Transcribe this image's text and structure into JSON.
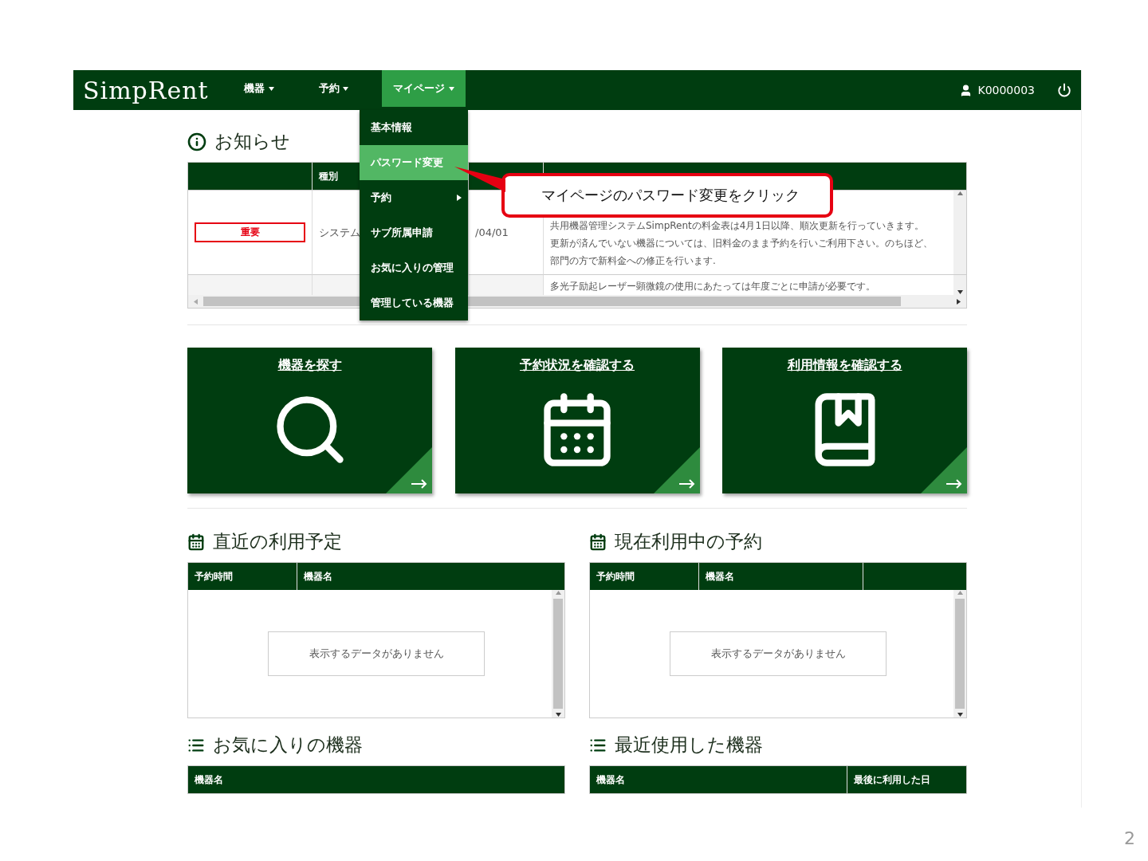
{
  "nav": {
    "logo": "SimpRent",
    "items": [
      {
        "label": "機器",
        "selected": false
      },
      {
        "label": "予約",
        "selected": false
      },
      {
        "label": "マイページ",
        "selected": true
      }
    ],
    "user": "K0000003"
  },
  "dropdown": [
    {
      "label": "基本情報",
      "selected": false,
      "kind": "link"
    },
    {
      "label": "パスワード変更",
      "selected": true,
      "kind": "link"
    },
    {
      "label": "予約",
      "selected": false,
      "kind": "submenu"
    },
    {
      "label": "サブ所属申請",
      "selected": false,
      "kind": "link"
    },
    {
      "label": "お気に入りの管理",
      "selected": false,
      "kind": "link"
    },
    {
      "label": "管理している機器",
      "selected": false,
      "kind": "link"
    }
  ],
  "callout": "マイページのパスワード変更をクリック",
  "notices": {
    "title": "お知らせ",
    "type_header": "種別",
    "rows": [
      {
        "badge": "重要",
        "type": "システム",
        "date": "/04/01",
        "lines": [
          "共用機器管理システムSimpRentの料金表は4月1日以降、順次更新を行っていきます。",
          "更新が済んでいない機器については、旧料金のまま予約を行いご利用下さい。のちほど、",
          "部門の方で新料金への修正を行います."
        ]
      },
      {
        "lines": [
          "多光子励起レーザー顕微鏡の使用にあたっては年度ごとに申請が必要です。"
        ]
      }
    ]
  },
  "tiles": [
    {
      "title": "機器を探す",
      "kind": "search"
    },
    {
      "title": "予約状況を確認する",
      "kind": "calendar"
    },
    {
      "title": "利用情報を確認する",
      "kind": "book"
    }
  ],
  "sections": [
    {
      "title": "直近の利用予定",
      "kind": "calendar",
      "columns": [
        "予約時間",
        "機器名"
      ],
      "empty": "表示するデータがありません"
    },
    {
      "title": "現在利用中の予約",
      "kind": "calendar",
      "columns": [
        "予約時間",
        "機器名"
      ],
      "empty": "表示するデータがありません"
    },
    {
      "title": "お気に入りの機器",
      "kind": "list",
      "columns": [
        "機器名"
      ]
    },
    {
      "title": "最近使用した機器",
      "kind": "list",
      "columns": [
        "機器名",
        "最後に利用した日"
      ]
    }
  ],
  "page_number": "2"
}
